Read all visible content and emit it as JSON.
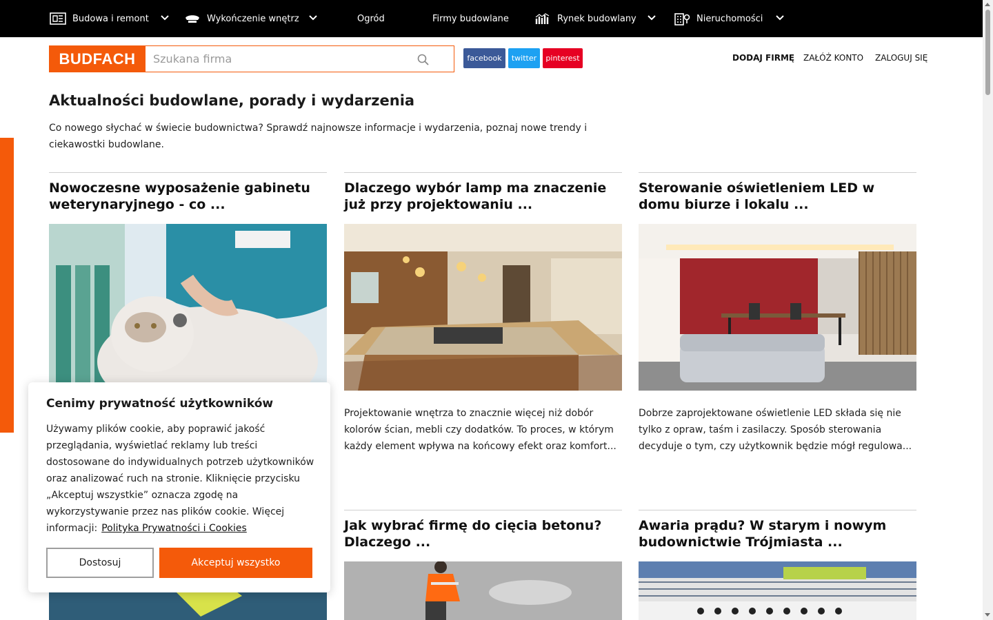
{
  "nav": {
    "items": [
      {
        "label": "Budowa i remont",
        "icon": "house-plan-icon",
        "has_dropdown": true
      },
      {
        "label": "Wykończenie wnętrz",
        "icon": "paint-roller-icon",
        "has_dropdown": true
      },
      {
        "label": "Ogród",
        "icon": "",
        "has_dropdown": false
      },
      {
        "label": "Firmy budowlane",
        "icon": "",
        "has_dropdown": false
      },
      {
        "label": "Rynek budowlany",
        "icon": "bar-chart-icon",
        "has_dropdown": true
      },
      {
        "label": "Nieruchomości",
        "icon": "building-pin-icon",
        "has_dropdown": true
      }
    ]
  },
  "header": {
    "logo": "BUDFACH",
    "search_placeholder": "Szukana firma",
    "social": {
      "facebook": "facebook",
      "twitter": "twitter",
      "pinterest": "pinterest"
    },
    "links": {
      "add_company": "DODAJ FIRMĘ",
      "register": "ZAŁÓŻ KONTO",
      "login": "ZALOGUJ SIĘ"
    }
  },
  "intro": {
    "title": "Aktualności budowlane, porady i wydarzenia",
    "description": "Co nowego słychać w świecie budownictwa? Sprawdź najnowsze informacje i wydarzenia, poznaj nowe trendy i ciekawostki budowlane."
  },
  "articles": [
    {
      "title": "Nowoczesne wyposażenie gabinetu weterynaryjnego - co ...",
      "excerpt": ""
    },
    {
      "title": "Dlaczego wybór lamp ma znaczenie już przy projektowaniu ...",
      "excerpt": "Projektowanie wnętrza to znacznie więcej niż dobór kolorów ścian, mebli czy dodatków. To proces, w którym każdy element wpływa na końcowy efekt oraz komfort..."
    },
    {
      "title": "Sterowanie oświetleniem LED w domu biurze i lokalu ...",
      "excerpt": "Dobrze zaprojektowane oświetlenie LED składa się nie tylko z opraw, taśm i zasilaczy. Sposób sterowania decyduje o tym, czy użytkownik będzie mógł regulowa..."
    },
    {
      "title": "Jak wybrać firmę do cięcia betonu? Dlaczego ...",
      "excerpt": ""
    },
    {
      "title": "Awaria prądu? W starym i nowym budownictwie Trójmiasta ...",
      "excerpt": ""
    }
  ],
  "cookie": {
    "title": "Cenimy prywatność użytkowników",
    "text": "Używamy plików cookie, aby poprawić jakość przeglądania, wyświetlać reklamy lub treści dostosowane do indywidualnych potrzeb użytkowników oraz analizować ruch na stronie. Kliknięcie przycisku „Akceptuj wszystkie” oznacza zgodę na wykorzystywanie przez nas plików cookie. Więcej informacji:",
    "link": "Polityka Prywatności i Cookies",
    "customize": "Dostosuj",
    "accept": "Akceptuj wszystko"
  },
  "colors": {
    "accent": "#f45a0a",
    "nav_bg": "#000000",
    "facebook": "#3b5998",
    "twitter": "#1da1f2",
    "pinterest": "#e60023"
  }
}
